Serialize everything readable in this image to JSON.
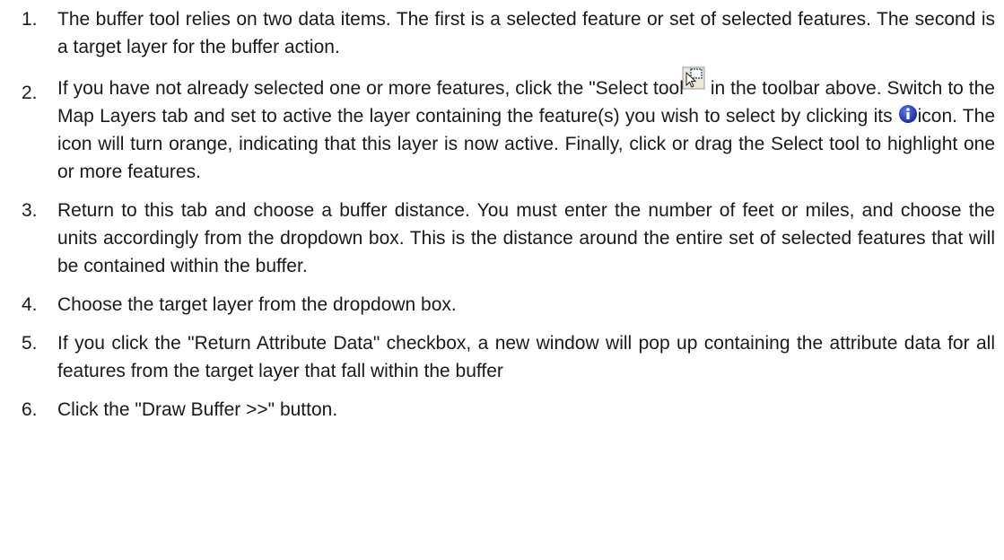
{
  "steps": [
    {
      "number": "1.",
      "text": "The buffer tool relies on two data items. The first is a selected feature or set of selected features. The second is a target layer for the buffer action."
    },
    {
      "number": "2.",
      "text_before_select_icon": "If you have not already selected one or more features, click the \"Select tool",
      "text_before_info_icon": "in the toolbar above. Switch to the Map Layers tab and set to active the layer containing the feature(s) you wish to select by clicking its",
      "text_after_info_icon": "icon. The icon will turn orange, indicating that this layer is now active. Finally, click or drag the Select tool to highlight one or more features.",
      "select_icon": "select-tool-icon",
      "info_icon": "info-icon"
    },
    {
      "number": "3.",
      "text": "Return to this tab and choose a buffer distance. You must enter the number of feet or miles, and choose the units accordingly from the dropdown box. This is the distance around the entire set of selected features that will be contained within the buffer."
    },
    {
      "number": "4.",
      "text": "Choose the target layer from the dropdown box."
    },
    {
      "number": "5.",
      "text": "If you click the \"Return Attribute Data\" checkbox, a new window will pop up containing the attribute data for all features from the target layer that fall within the buffer"
    },
    {
      "number": "6.",
      "text": "Click the \"Draw Buffer >>\" button."
    }
  ],
  "colors": {
    "text": "#1a1a1a",
    "info_icon": "#1a2e9e",
    "select_icon_frame": "#3a5a8a"
  }
}
